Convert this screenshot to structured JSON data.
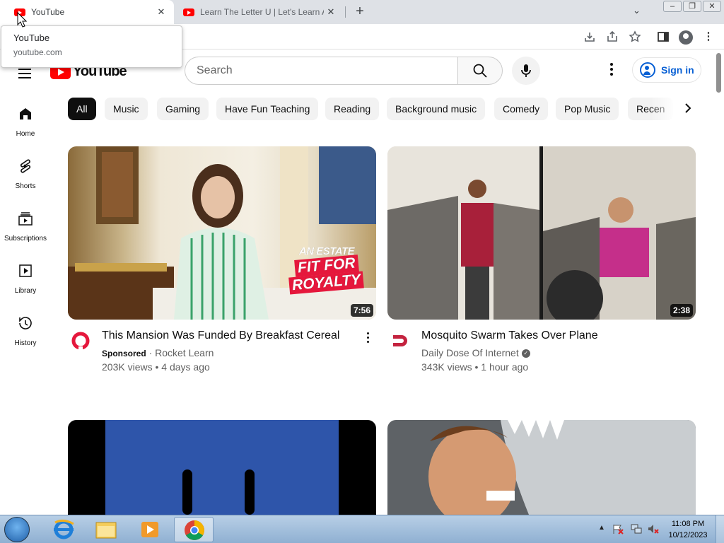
{
  "browser": {
    "tabs": [
      {
        "title": "YouTube",
        "active": true
      },
      {
        "title": "Learn The Letter U | Let's Learn A",
        "active": false
      }
    ],
    "new_tab_label": "+",
    "tab_search_label": "⌄",
    "tooltip": {
      "title": "YouTube",
      "url": "youtube.com"
    },
    "window_buttons": [
      "–",
      "❐",
      "✕"
    ],
    "toolbar_icons": [
      "install-icon",
      "share-icon",
      "bookmark-star-icon",
      "side-panel-icon",
      "profile-icon",
      "menu-icon"
    ]
  },
  "youtube": {
    "logo_text": "YouTube",
    "search": {
      "placeholder": "Search"
    },
    "signin_label": "Sign in",
    "sidebar": [
      {
        "label": "Home",
        "icon": "home-icon"
      },
      {
        "label": "Shorts",
        "icon": "shorts-icon"
      },
      {
        "label": "Subscriptions",
        "icon": "subscriptions-icon"
      },
      {
        "label": "Library",
        "icon": "library-icon"
      },
      {
        "label": "History",
        "icon": "history-icon"
      }
    ],
    "chips": [
      "All",
      "Music",
      "Gaming",
      "Have Fun Teaching",
      "Reading",
      "Background music",
      "Comedy",
      "Pop Music",
      "Recen"
    ],
    "videos": [
      {
        "title": "This Mansion Was Funded By Breakfast Cereal",
        "sponsored": "Sponsored",
        "channel": "Rocket Learn",
        "stats": "203K views • 4 days ago",
        "duration": "7:56",
        "thumb_text": [
          "AN ESTATE",
          "FIT FOR",
          "ROYALTY"
        ]
      },
      {
        "title": "Mosquito Swarm Takes Over Plane",
        "channel": "Daily Dose Of Internet",
        "stats": "343K views • 1 hour ago",
        "duration": "2:38"
      }
    ]
  },
  "taskbar": {
    "time": "11:08 PM",
    "date": "10/12/2023",
    "apps": [
      "internet-explorer-icon",
      "file-explorer-icon",
      "media-player-icon",
      "chrome-icon"
    ]
  }
}
